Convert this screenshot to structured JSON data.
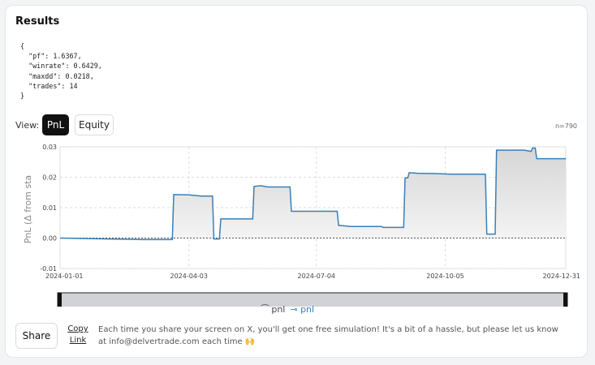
{
  "section_title": "Results",
  "results_json": "{\n  \"pf\": 1.6367,\n  \"winrate\": 0.6429,\n  \"maxdd\": 0.0218,\n  \"trades\": 14\n}",
  "view": {
    "label": "View:",
    "options": [
      "PnL",
      "Equity"
    ],
    "selected": "PnL"
  },
  "n_label": "n=790",
  "chart_data": {
    "type": "line",
    "ylabel": "PnL (Δ from sta",
    "xlabel": "",
    "x_ticks": [
      "2024-01-01",
      "2024-04-03",
      "2024-07-04",
      "2024-10-05",
      "2024-12-31"
    ],
    "y_ticks": [
      "0.03",
      "0.02",
      "0.01",
      "0.00",
      "-0.01"
    ],
    "ylim": [
      -0.01,
      0.03
    ],
    "xlim": [
      "2024-01-01",
      "2024-12-31"
    ],
    "grid": true,
    "legend": "bottom",
    "legend_entries": [
      "pnl",
      "pnl"
    ],
    "series": [
      {
        "name": "pnl",
        "color": "#3a7fb8",
        "x": [
          "2024-01-01",
          "2024-03-01",
          "2024-03-22",
          "2024-03-23",
          "2024-04-03",
          "2024-04-12",
          "2024-04-20",
          "2024-04-21",
          "2024-04-25",
          "2024-04-26",
          "2024-05-17",
          "2024-05-19",
          "2024-05-20",
          "2024-05-25",
          "2024-05-30",
          "2024-06-15",
          "2024-06-16",
          "2024-06-30",
          "2024-07-19",
          "2024-07-20",
          "2024-07-29",
          "2024-08-20",
          "2024-08-21",
          "2024-09-05",
          "2024-09-06",
          "2024-09-08",
          "2024-09-09",
          "2024-09-15",
          "2024-09-28",
          "2024-10-10",
          "2024-11-03",
          "2024-11-04",
          "2024-11-10",
          "2024-11-11",
          "2024-12-01",
          "2024-12-06",
          "2024-12-07",
          "2024-12-09",
          "2024-12-10",
          "2024-12-31"
        ],
        "y": [
          0.0,
          -0.0005,
          -0.0005,
          0.0143,
          0.0142,
          0.0138,
          0.0138,
          -0.0003,
          -0.0003,
          0.0063,
          0.0063,
          0.0063,
          0.017,
          0.0172,
          0.0168,
          0.0168,
          0.0088,
          0.0088,
          0.0088,
          0.0042,
          0.0038,
          0.0038,
          0.0035,
          0.0035,
          0.0198,
          0.0198,
          0.0215,
          0.0213,
          0.0212,
          0.021,
          0.021,
          0.0013,
          0.0013,
          0.0289,
          0.0289,
          0.0285,
          0.0296,
          0.0296,
          0.0261,
          0.0261
        ]
      }
    ],
    "colors": {
      "line": "#3a7fb8",
      "fill_top": "#dcdcdc",
      "zero_line": "#555555",
      "grid": "#dddddd"
    }
  },
  "share": {
    "label": "Share",
    "copy_link": "Copy Link"
  },
  "note": "Each time you share your screen on X, you'll get one free simulation! It's a bit of a hassle, but please let us know at info@delvertrade.com each time 🙌"
}
